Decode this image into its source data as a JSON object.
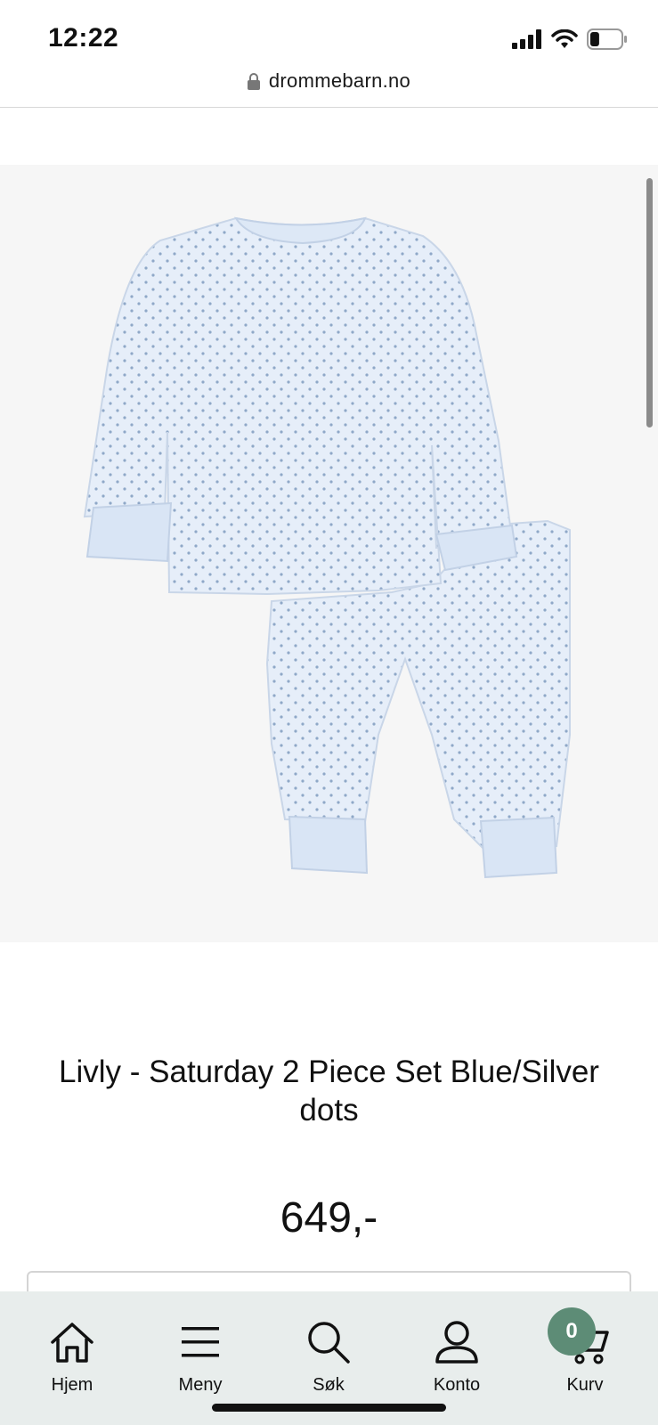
{
  "status_bar": {
    "time": "12:22",
    "battery_level": 0.3
  },
  "browser": {
    "url": "drommebarn.no"
  },
  "product": {
    "image_icon": "pajama-set-image",
    "title": "Livly - Saturday 2 Piece Set Blue/Silver dots",
    "price": "649,-"
  },
  "bottom_nav": {
    "items": [
      {
        "label": "Hjem",
        "icon": "home-icon"
      },
      {
        "label": "Meny",
        "icon": "menu-icon"
      },
      {
        "label": "Søk",
        "icon": "search-icon"
      },
      {
        "label": "Konto",
        "icon": "user-icon"
      },
      {
        "label": "Kurv",
        "icon": "cart-icon"
      }
    ],
    "cart_count": "0"
  },
  "colors": {
    "badge": "#5d8c76",
    "nav_bg": "#e8edec",
    "garment": "#dde8f6",
    "dots": "#8fa8c8"
  }
}
